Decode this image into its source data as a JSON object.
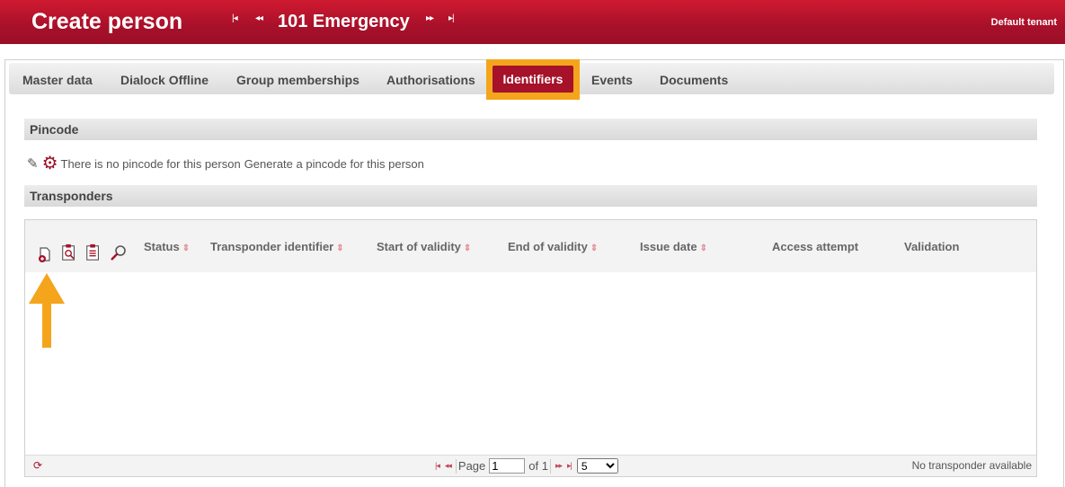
{
  "header": {
    "title": "Create person",
    "nav_first": "|◂",
    "nav_prev": "◂◂",
    "record": "101 Emergency",
    "nav_next": "▸▸",
    "nav_last": "▸|",
    "tenant": "Default tenant"
  },
  "tabs": {
    "master_data": "Master data",
    "dialock_offline": "Dialock Offline",
    "group_memberships": "Group memberships",
    "authorisations": "Authorisations",
    "identifiers": "Identifiers",
    "events": "Events",
    "documents": "Documents"
  },
  "pincode": {
    "section_title": "Pincode",
    "no_pincode_text": "There is no pincode for this person",
    "generate_link": "Generate a pincode for this person"
  },
  "transponders": {
    "section_title": "Transponders",
    "columns": {
      "status": "Status",
      "transponder_identifier": "Transponder identifier",
      "start_of_validity": "Start of validity",
      "end_of_validity": "End of validity",
      "issue_date": "Issue date",
      "access_attempt": "Access attempt",
      "validation": "Validation"
    },
    "sort_glyph": "⇕",
    "pager": {
      "first": "|◂",
      "prev": "◂◂",
      "page_label": "Page",
      "page_value": "1",
      "of_label": "of 1",
      "next": "▸▸",
      "last": "▸|",
      "page_size": "5"
    },
    "empty_text": "No transponder available"
  },
  "colors": {
    "brand": "#a5122a",
    "highlight": "#f4a51c"
  }
}
